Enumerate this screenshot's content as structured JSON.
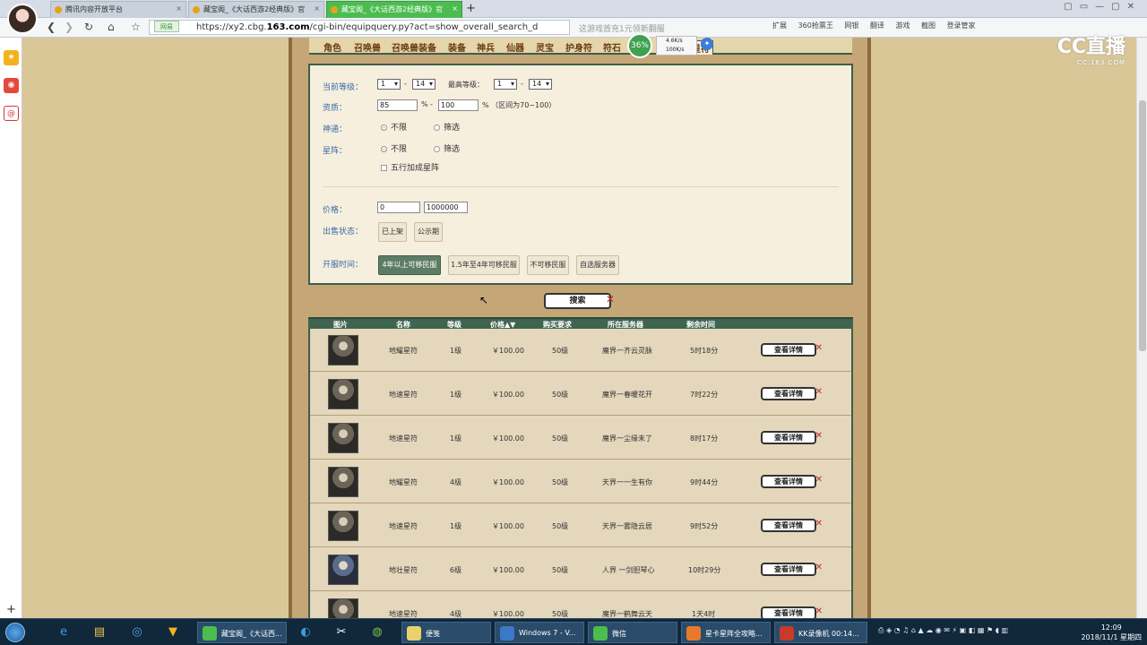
{
  "browser": {
    "tabs": [
      {
        "label": "腾讯内容开放平台",
        "active": false
      },
      {
        "label": "藏宝阁_《大话西游2经典版》官",
        "active": false
      },
      {
        "label": "藏宝阁_《大话西游2经典版》官",
        "active": true
      }
    ],
    "new_tab": "+",
    "url_prefix": "https://xy2.cbg.",
    "url_domain": "163.com",
    "url_path": "/cgi-bin/equipquery.py?act=show_overall_search_d",
    "security_label": "网易",
    "search_hint": "这游戏首充1元领新翻服",
    "extensions": [
      "扩展",
      "360抢票王",
      "网银",
      "翻译",
      "游戏",
      "截图"
    ],
    "login_label": "登录管家"
  },
  "watermark": {
    "brand": "CC直播",
    "sub": "CC.163.COM"
  },
  "speed_widget": {
    "percent": "36%",
    "up": "4.6K/s",
    "down": "100K/s"
  },
  "menu": [
    "角色",
    "召唤兽",
    "召唤兽装备",
    "装备",
    "神兵",
    "仙器",
    "灵宝",
    "护身符",
    "符石",
    "星符"
  ],
  "form": {
    "current_level_label": "当前等级：",
    "current_level_from": "1",
    "current_level_to": "14",
    "max_level_label": "最高等级：",
    "max_level_from": "1",
    "max_level_to": "14",
    "quality_label": "资质：",
    "quality_from": "85",
    "quality_to": "100",
    "percent_sign": "%",
    "range_note": "% （区间为70~100）",
    "dash": "-",
    "shentong_label": "神通：",
    "xingzhen_label": "星阵：",
    "opt_unlimited": "不限",
    "opt_filter": "筛选",
    "wuxing_label": "五行加成星阵",
    "price_label": "价格：",
    "price_from": "0",
    "price_to": "1000000",
    "sale_status_label": "出售状态：",
    "sale_status_options": [
      "已上架",
      "公示期"
    ],
    "open_time_label": "开服时间：",
    "open_time_options": [
      "4年以上可移民服",
      "1.5年至4年可移民服",
      "不可移民服",
      "自选服务器"
    ]
  },
  "search_button": "搜索",
  "table": {
    "headers": [
      "图片",
      "名称",
      "等级",
      "价格▲▼",
      "购买要求",
      "所在服务器",
      "剩余时间"
    ],
    "detail_label": "查看详情",
    "rows": [
      {
        "name": "地耀星符",
        "level": "1级",
        "price": "￥100.00",
        "req": "50级",
        "server": "魔界一齐云灵脉",
        "time": "5时18分"
      },
      {
        "name": "地速星符",
        "level": "1级",
        "price": "￥100.00",
        "req": "50级",
        "server": "魔界一春暖花开",
        "time": "7时22分"
      },
      {
        "name": "地速星符",
        "level": "1级",
        "price": "￥100.00",
        "req": "50级",
        "server": "魔界一尘缘未了",
        "time": "8时17分"
      },
      {
        "name": "地耀星符",
        "level": "4级",
        "price": "￥100.00",
        "req": "50级",
        "server": "天界一一生有你",
        "time": "9时44分"
      },
      {
        "name": "地速星符",
        "level": "1级",
        "price": "￥100.00",
        "req": "50级",
        "server": "天界一雾隐云居",
        "time": "9时52分"
      },
      {
        "name": "地壮星符",
        "level": "6级",
        "price": "￥100.00",
        "req": "50级",
        "server": "人界 一剑胆琴心",
        "time": "10时29分"
      },
      {
        "name": "地速星符",
        "level": "4级",
        "price": "￥100.00",
        "req": "50级",
        "server": "魔界一鹤舞云天",
        "time": "1天4时"
      }
    ]
  },
  "taskbar": {
    "tasks": [
      "藏宝阁_《大话西...",
      "便笺",
      "Windows 7 - V...",
      "微信",
      "星卡星阵全攻略...",
      "KK录像机 00:14..."
    ],
    "time": "12:09",
    "date": "2018/11/1 星期四"
  }
}
